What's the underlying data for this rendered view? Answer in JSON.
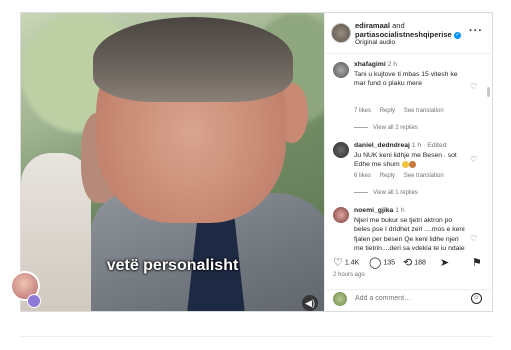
{
  "video": {
    "caption": "vetë personalisht",
    "mute_icon": "speaker-muted-icon"
  },
  "header": {
    "user1": "ediramaal",
    "and": "and",
    "user2": "partiasocialistneshqiperise",
    "subtitle": "Original audio",
    "more_icon": "more-dots-icon"
  },
  "comments": [
    {
      "user": "xhafagimi",
      "time": "2 h",
      "text": "Tani u kujtove ti mbas 15 vitesh ke mar fund o plaku mere",
      "likes": "7 likes",
      "reply": "Reply",
      "translate": "See translation",
      "view_replies": "View all 2 replies"
    },
    {
      "user": "daniel_dedndreaj",
      "time": "1 h · Edited",
      "text": "Ju NUK keni lidhje me Besen . sot Edhe me shum",
      "likes": "6 likes",
      "reply": "Reply",
      "translate": "See translation",
      "view_replies": "View all 1 replies"
    },
    {
      "user": "noemi_gjika",
      "time": "1 h",
      "text": "Njeri me bukur se tjetri aktron po beles pse I dridhet zeri ....mos e keni fjalen per besen Qe keni lidhe njeri me tjetrin....deri sa vdekja te ju ndaje"
    }
  ],
  "actions": {
    "likes_count": "1.4K",
    "comments_count": "135",
    "reposts_count": "188"
  },
  "post_time": "2 hours ago",
  "add_comment_placeholder": "Add a comment…"
}
